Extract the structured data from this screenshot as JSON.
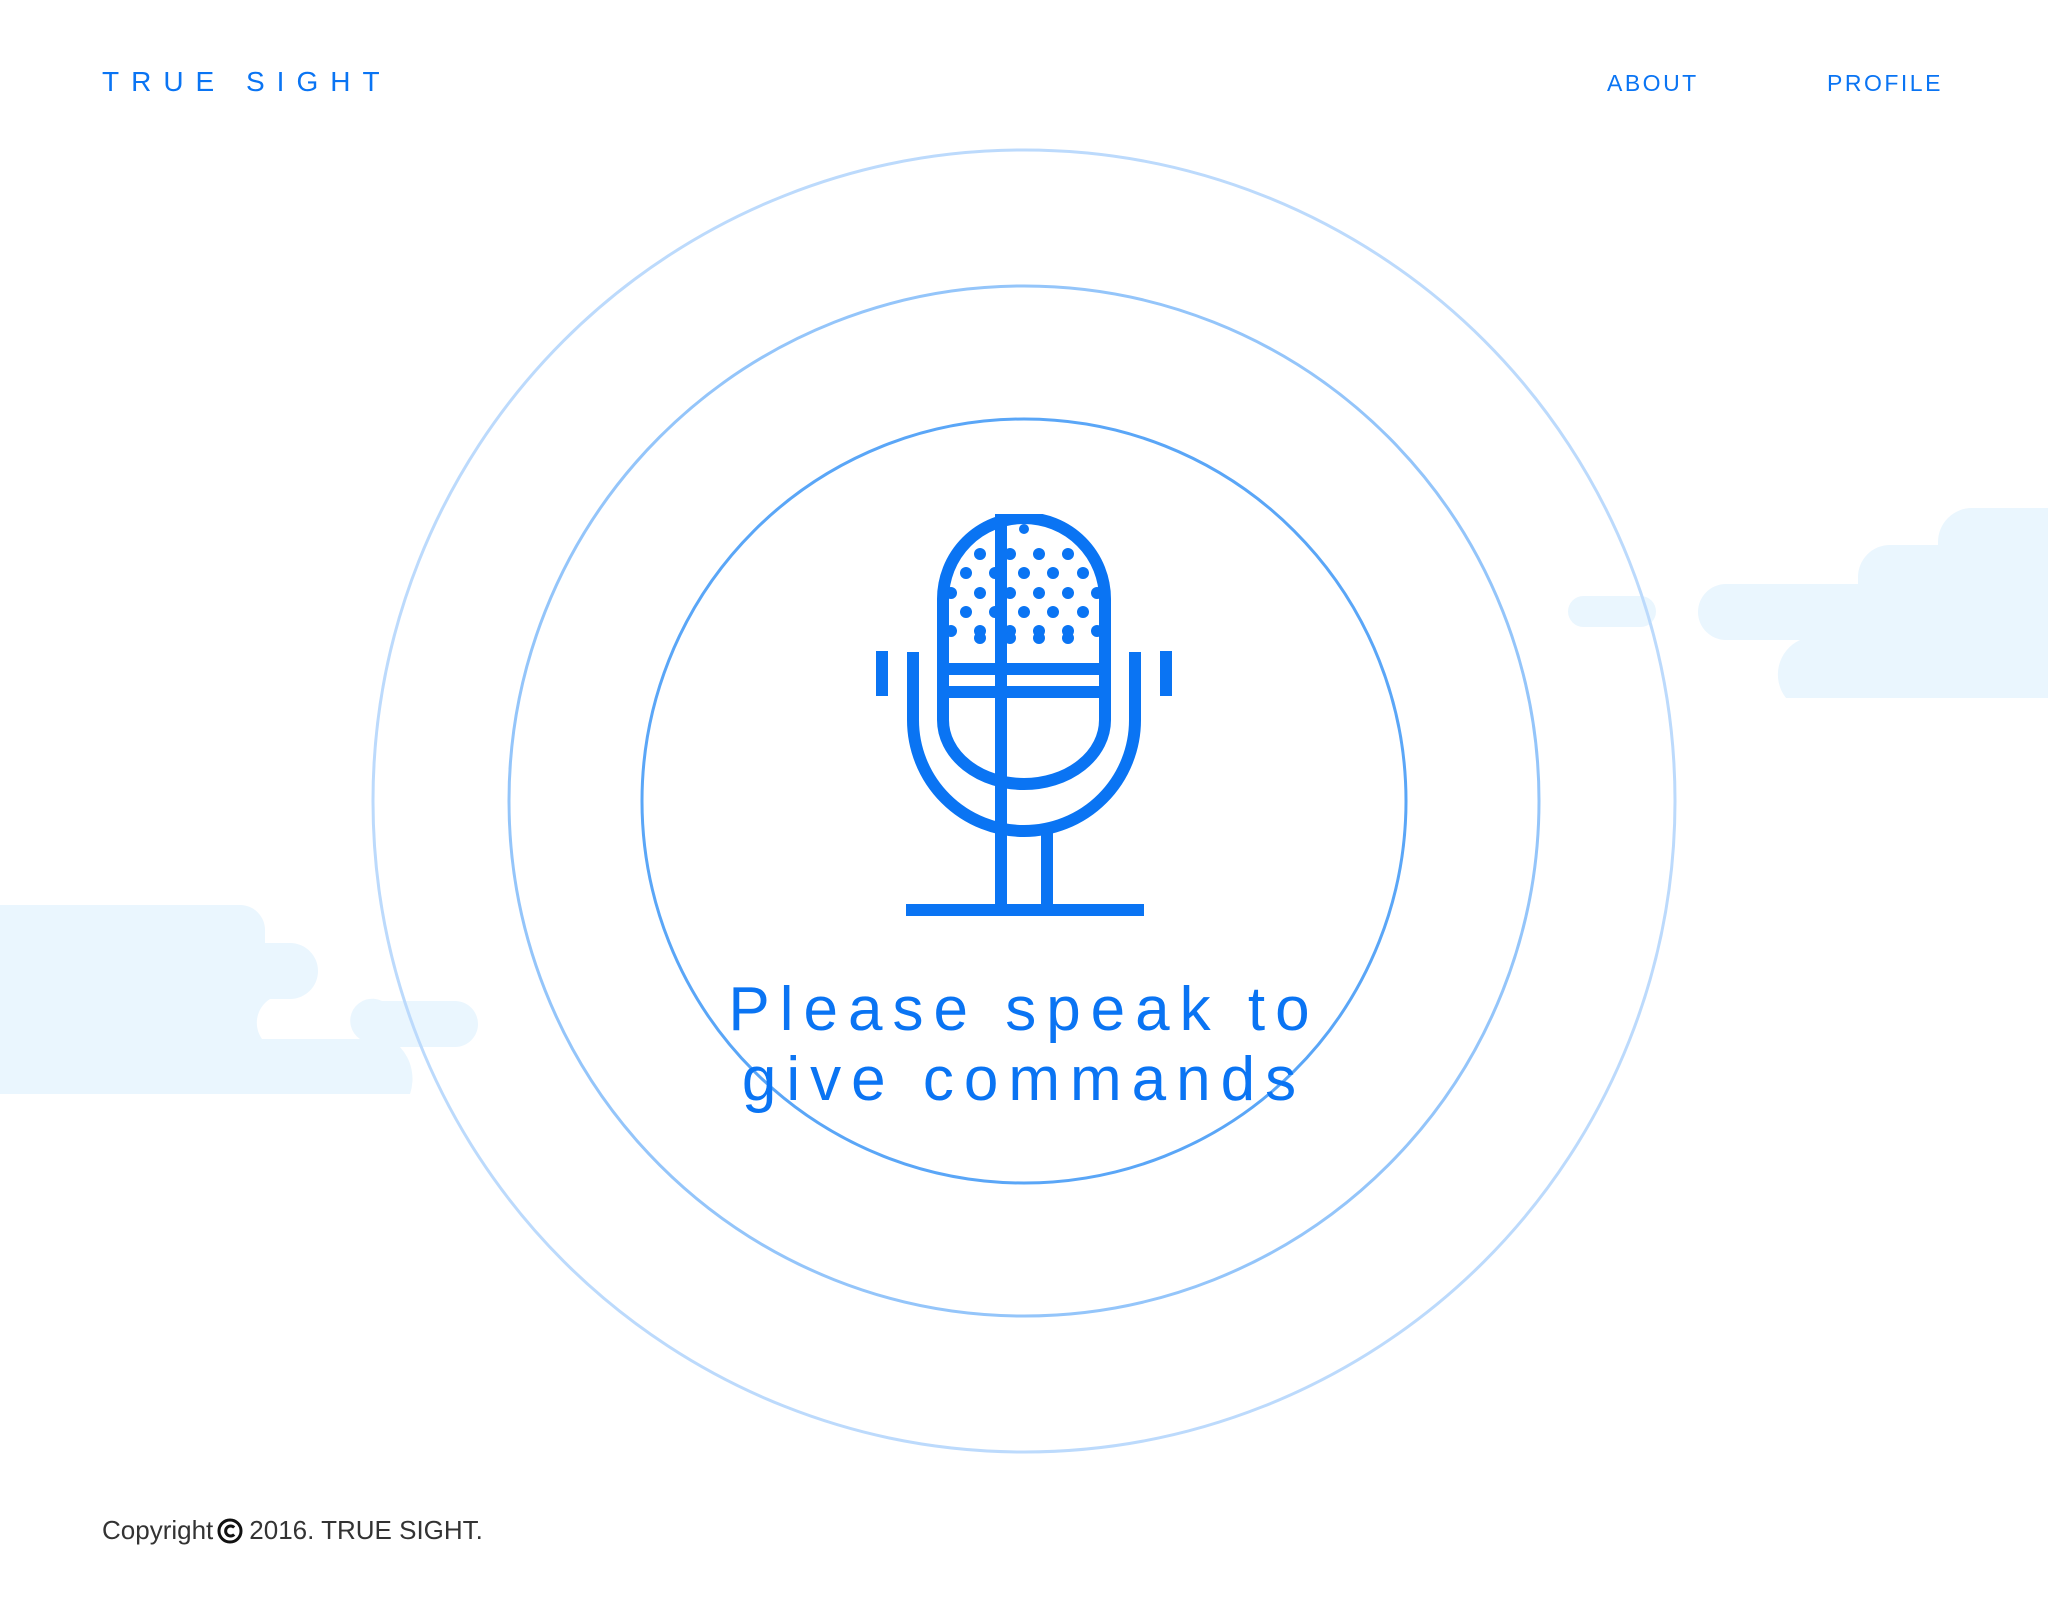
{
  "header": {
    "brand": "TRUE SIGHT",
    "nav": [
      {
        "label": "ABOUT"
      },
      {
        "label": "PROFILE"
      }
    ]
  },
  "main": {
    "prompt_line1": "Please speak to",
    "prompt_line2": "give commands",
    "mic_icon": "microphone-icon"
  },
  "footer": {
    "copyright_prefix": "Copyright",
    "copyright_icon": "copyright-icon",
    "copyright_suffix": "2016. TRUE SIGHT."
  },
  "colors": {
    "accent": "#0a74f3",
    "ring_inner": "#5aa6f7",
    "ring_middle": "#94c5fa",
    "ring_outer": "#bcdafc",
    "cloud": "#eaf6fe",
    "background": "#ffffff",
    "footer_text": "#333333"
  }
}
